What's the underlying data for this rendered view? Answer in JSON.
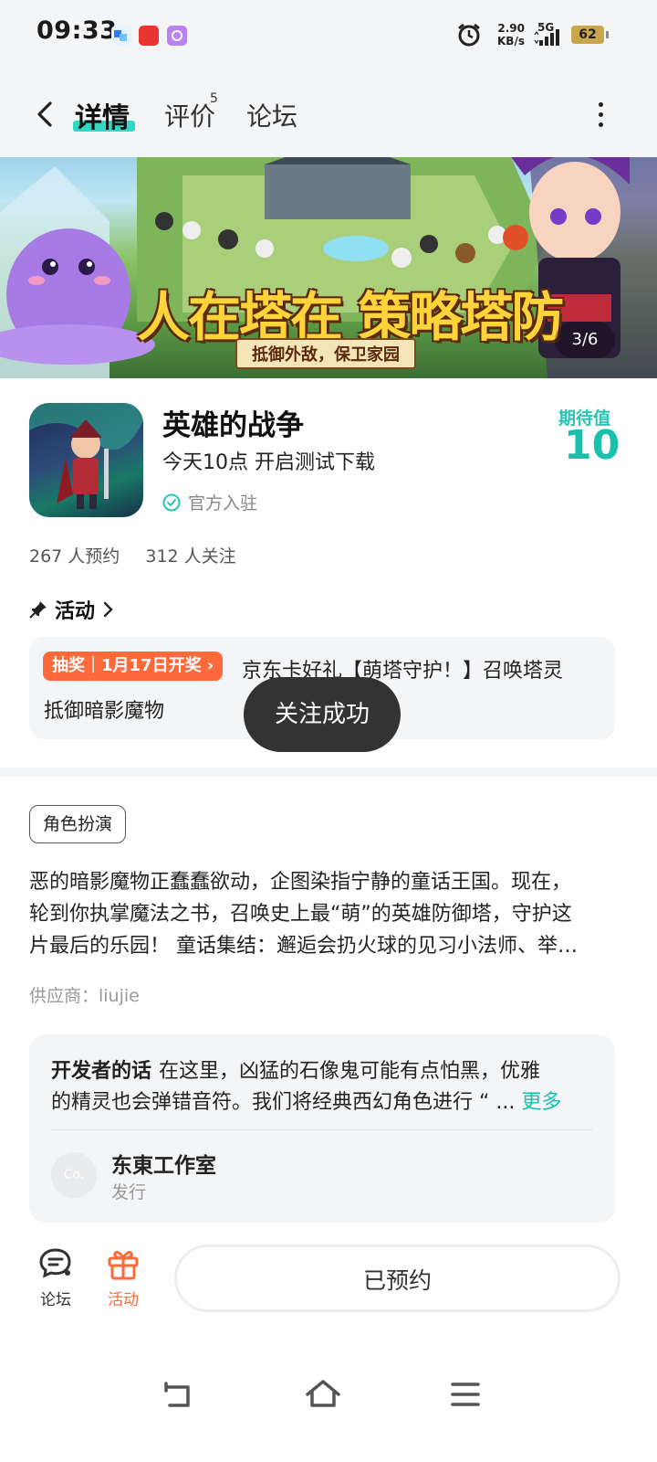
{
  "status_bar": {
    "time": "09:33",
    "speed_value": "2.90",
    "speed_unit": "KB/s",
    "network": "5G",
    "battery": "62"
  },
  "header": {
    "tabs": [
      {
        "label": "详情",
        "active": true
      },
      {
        "label": "评价",
        "badge": "5"
      },
      {
        "label": "论坛"
      }
    ]
  },
  "banner": {
    "title": "人在塔在 策略塔防",
    "subtitle": "抵御外敌，保卫家园",
    "counter": "3/6"
  },
  "game": {
    "title": "英雄的战争",
    "subtitle": "今天10点 开启测试下载",
    "official": "官方入驻",
    "expect_label": "期待值",
    "expect_value": "10",
    "reservations": "267 人预约",
    "followers": "312 人关注"
  },
  "activity": {
    "heading": "活动",
    "badge": "抽奖｜1月17日开奖",
    "text_line1": "京东卡好礼【萌塔守护！】召唤塔灵",
    "text_line2": "抵御暗影魔物"
  },
  "toast": "关注成功",
  "tag": "角色扮演",
  "description": [
    "恶的暗影魔物正蠢蠢欲动，企图染指宁静的童话王国。现在，",
    "轮到你执掌魔法之书，召唤史上最“萌”的英雄防御塔，守护这",
    "片最后的乐园！ 童话集结：邂逅会扔火球的见习小法师、举…"
  ],
  "supplier": "供应商：liujie",
  "developer": {
    "label": "开发者的话",
    "line1": "在这里，凶猛的石像鬼可能有点怕黑，优雅",
    "line2": "的精灵也会弹错音符。我们将经典西幻角色进行 “ ...",
    "more": "更多",
    "studio_name": "东東工作室",
    "studio_role": "发行",
    "avatar_text": "Co."
  },
  "bottom_bar": {
    "forum": "论坛",
    "activity": "活动",
    "reserve_button": "已预约"
  },
  "colors": {
    "accent": "#18c0ad",
    "orange": "#ff6a3d",
    "background": "#f4f5f7"
  }
}
